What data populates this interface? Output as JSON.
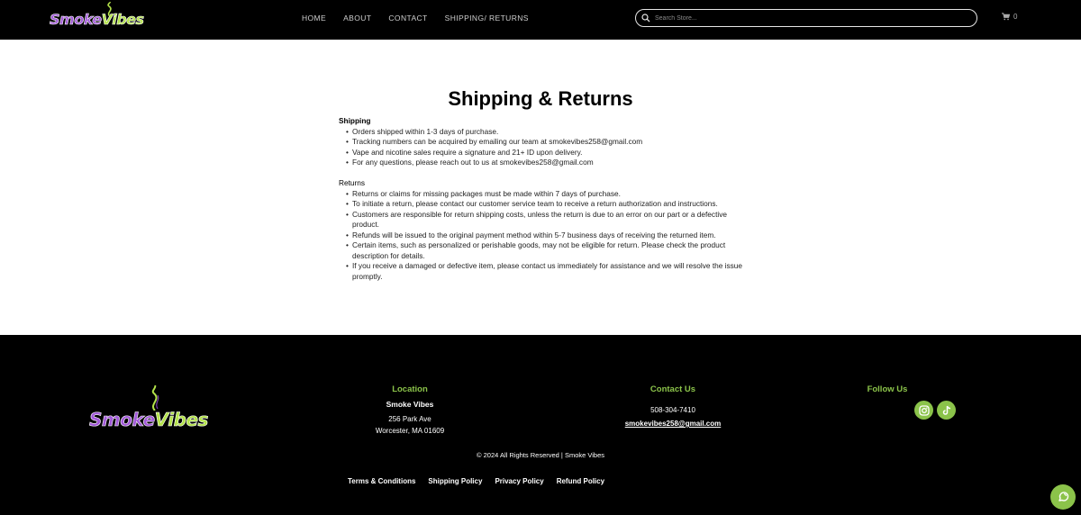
{
  "header": {
    "logo": {
      "part1": "Smoke",
      "part2": "Vibes"
    },
    "nav": [
      {
        "label": "HOME"
      },
      {
        "label": "ABOUT"
      },
      {
        "label": "CONTACT"
      },
      {
        "label": "SHIPPING/ RETURNS"
      }
    ],
    "search": {
      "placeholder": "Search Store..."
    },
    "cart": {
      "count": "0",
      "icon": "cart-icon"
    }
  },
  "main": {
    "title": "Shipping & Returns",
    "shipping": {
      "heading": "Shipping",
      "items": [
        "Orders shipped within 1-3 days of purchase.",
        "Tracking numbers can be acquired by emailing our team at smokevibes258@gmail.com",
        "Vape and nicotine sales require a signature and 21+ ID upon delivery.",
        "For any questions, please reach out to us at smokevibes258@gmail.com"
      ]
    },
    "returns": {
      "heading": "Returns",
      "items": [
        "Returns or claims for missing packages must be made within 7 days of purchase.",
        "To initiate a return, please contact our customer service team to receive a return authorization and instructions.",
        "Customers are responsible for return shipping costs, unless the return is due to an error on our part or a defective product.",
        "Refunds will be issued to the original payment method within 5-7 business days of receiving the returned item.",
        "Certain items, such as personalized or perishable goods, may not be eligible for return. Please check the product description for details.",
        "If you receive a damaged or defective item, please contact us immediately for assistance and we will resolve the issue promptly."
      ]
    }
  },
  "footer": {
    "logo": {
      "part1": "Smoke",
      "part2": "Vibes"
    },
    "location": {
      "title": "Location",
      "name": "Smoke Vibes",
      "street": "256 Park Ave",
      "city": "Worcester, MA 01609"
    },
    "contact": {
      "title": "Contact Us",
      "phone": "508-304-7410",
      "email": "smokevibes258@gmail.com"
    },
    "follow": {
      "title": "Follow Us",
      "icons": [
        "instagram-icon",
        "tiktok-icon"
      ]
    },
    "copyright": "© 2024 All Rights Reserved | Smoke Vibes",
    "legal_links": [
      {
        "label": "Terms & Conditions"
      },
      {
        "label": "Shipping Policy"
      },
      {
        "label": "Privacy Policy"
      },
      {
        "label": "Refund Policy"
      }
    ]
  },
  "colors": {
    "accent_green": "#8bc34a",
    "logo_purple": "#a259d9",
    "logo_green": "#b4e34a",
    "header_bg": "#000000"
  }
}
